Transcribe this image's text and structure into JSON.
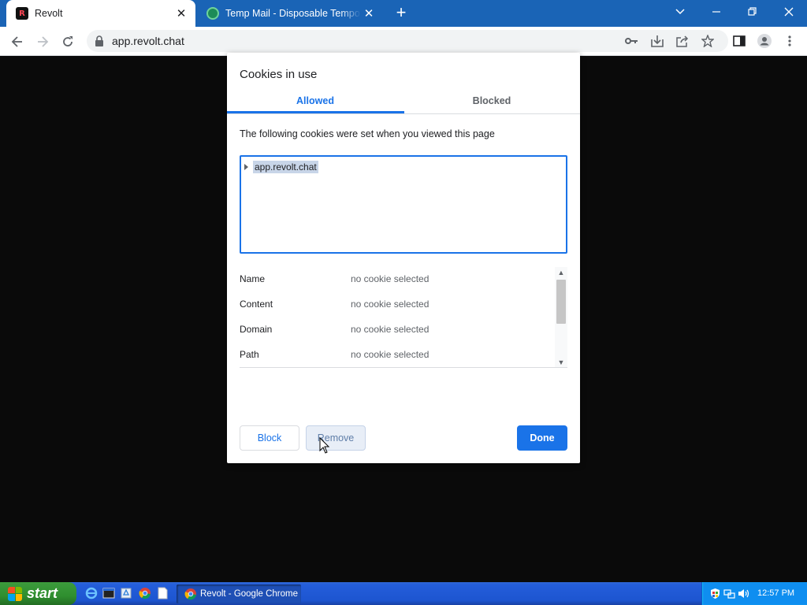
{
  "browser": {
    "tabs": [
      {
        "title": "Revolt",
        "active": true
      },
      {
        "title": "Temp Mail - Disposable Temporary Email",
        "active": false
      }
    ],
    "address_bar": {
      "url": "app.revolt.chat"
    }
  },
  "dialog": {
    "title": "Cookies in use",
    "tabs": [
      {
        "label": "Allowed",
        "selected": true
      },
      {
        "label": "Blocked",
        "selected": false
      }
    ],
    "description": "The following cookies were set when you viewed this page",
    "tree_items": [
      {
        "label": "app.revolt.chat",
        "selected": true
      }
    ],
    "details": [
      {
        "key": "Name",
        "value": "no cookie selected"
      },
      {
        "key": "Content",
        "value": "no cookie selected"
      },
      {
        "key": "Domain",
        "value": "no cookie selected"
      },
      {
        "key": "Path",
        "value": "no cookie selected"
      }
    ],
    "buttons": {
      "block": "Block",
      "remove": "Remove",
      "done": "Done"
    }
  },
  "taskbar": {
    "start_label": "start",
    "task_button": "Revolt - Google Chrome",
    "clock": "12:57 PM"
  },
  "colors": {
    "accent": "#1a73e8",
    "tabstrip": "#1a64b6",
    "taskbar": "#245edb",
    "start_green": "#3c9b3c"
  }
}
